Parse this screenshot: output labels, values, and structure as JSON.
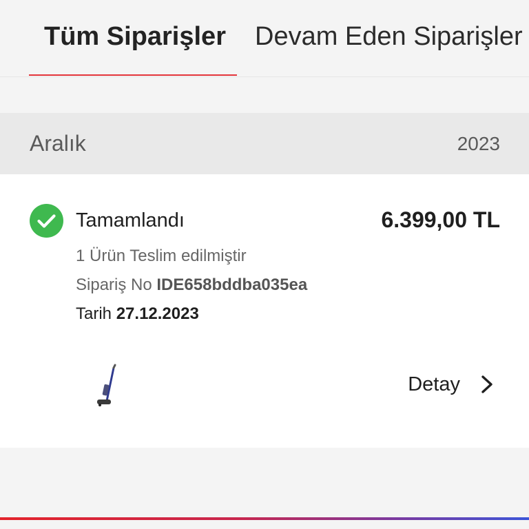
{
  "tabs": {
    "all_orders": "Tüm Siparişler",
    "ongoing_orders": "Devam Eden Siparişler"
  },
  "month_group": {
    "month": "Aralık",
    "year": "2023"
  },
  "order": {
    "status": "Tamamlandı",
    "status_icon": "check-circle-icon",
    "status_color": "#3fb94f",
    "price": "6.399,00 TL",
    "delivered_text": "1 Ürün Teslim edilmiştir",
    "order_no_label": "Sipariş No",
    "order_no": "IDE658bddba035ea",
    "date_label": "Tarih",
    "date": "27.12.2023",
    "product_icon": "stick-vacuum-image",
    "detail_label": "Detay",
    "detail_icon": "chevron-right-icon"
  },
  "colors": {
    "accent": "#e3343a",
    "background": "#f4f4f4",
    "card": "#ffffff"
  }
}
